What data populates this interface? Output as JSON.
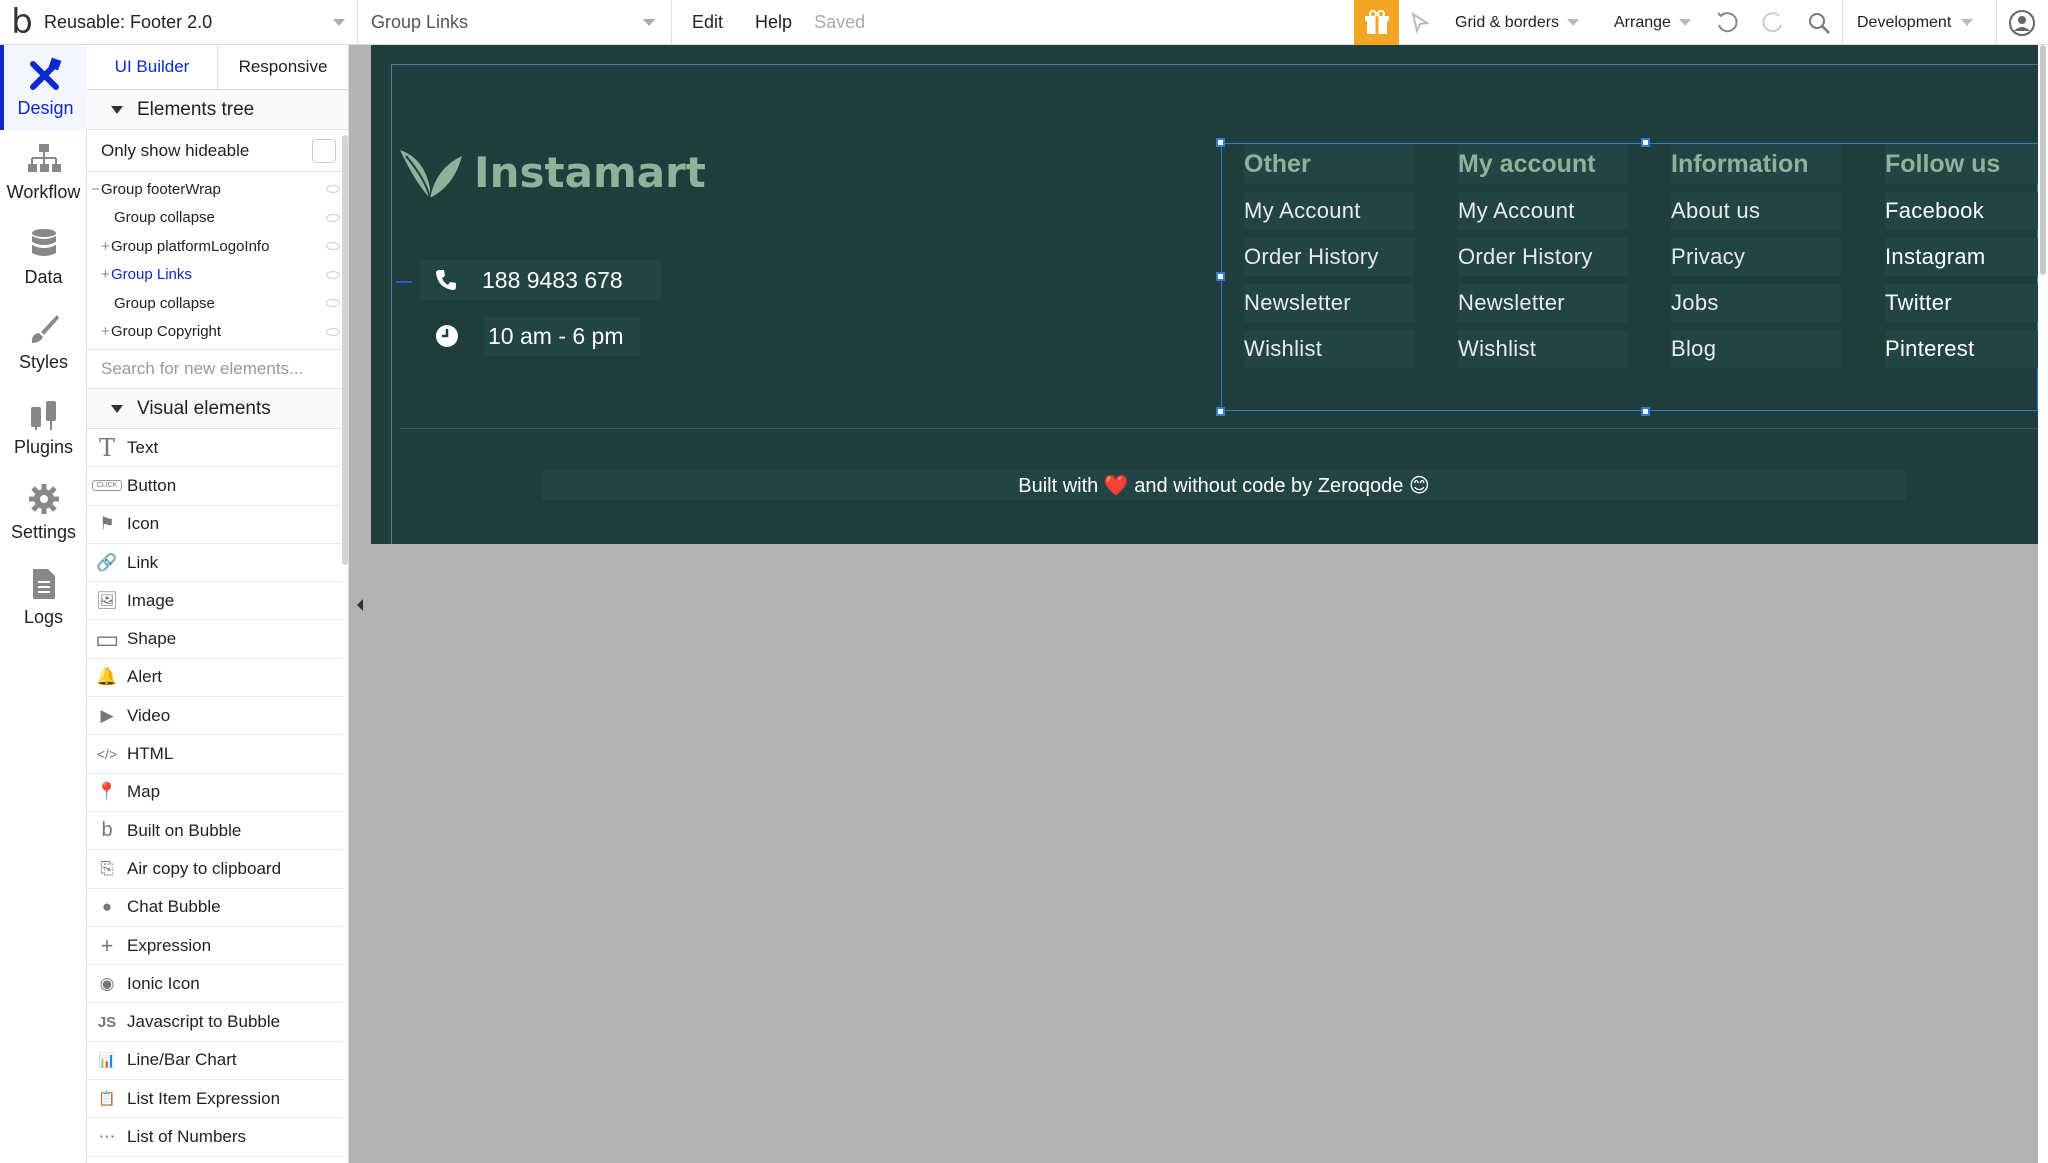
{
  "topbar": {
    "page_name": "Reusable: Footer 2.0",
    "element_select": "Group Links",
    "edit": "Edit",
    "help": "Help",
    "saved": "Saved",
    "grid": "Grid & borders",
    "arrange": "Arrange",
    "environment": "Development"
  },
  "rail": [
    {
      "label": "Design",
      "icon": "design-icon"
    },
    {
      "label": "Workflow",
      "icon": "workflow-icon"
    },
    {
      "label": "Data",
      "icon": "database-icon"
    },
    {
      "label": "Styles",
      "icon": "brush-icon"
    },
    {
      "label": "Plugins",
      "icon": "plug-icon"
    },
    {
      "label": "Settings",
      "icon": "gear-icon"
    },
    {
      "label": "Logs",
      "icon": "document-icon"
    }
  ],
  "panel": {
    "tab_builder": "UI Builder",
    "tab_responsive": "Responsive",
    "tree_header": "Elements tree",
    "only_hideable": "Only show hideable",
    "tree": [
      {
        "prefix": "−",
        "label": "Group footerWrap",
        "indent": 0
      },
      {
        "prefix": "",
        "label": "Group collapse",
        "indent": 1
      },
      {
        "prefix": "+",
        "label": "Group platformLogoInfo",
        "indent": 0
      },
      {
        "prefix": "+",
        "label": "Group Links",
        "indent": 0
      },
      {
        "prefix": "",
        "label": "Group collapse",
        "indent": 1
      },
      {
        "prefix": "+",
        "label": "Group Copyright",
        "indent": 0
      }
    ],
    "search_placeholder": "Search for new elements...",
    "visual_header": "Visual elements",
    "elements": [
      {
        "icon": "T",
        "label": "Text"
      },
      {
        "icon": "CLICK",
        "label": "Button"
      },
      {
        "icon": "⚑",
        "label": "Icon"
      },
      {
        "icon": "🔗",
        "label": "Link"
      },
      {
        "icon": "🖼",
        "label": "Image"
      },
      {
        "icon": "▭",
        "label": "Shape"
      },
      {
        "icon": "🔔",
        "label": "Alert"
      },
      {
        "icon": "▶",
        "label": "Video"
      },
      {
        "icon": "</>",
        "label": "HTML"
      },
      {
        "icon": "📍",
        "label": "Map"
      },
      {
        "icon": "b",
        "label": "Built on Bubble"
      },
      {
        "icon": "⎘",
        "label": "Air copy to clipboard"
      },
      {
        "icon": "●",
        "label": "Chat Bubble"
      },
      {
        "icon": "+",
        "label": "Expression"
      },
      {
        "icon": "◉",
        "label": "Ionic Icon"
      },
      {
        "icon": "JS",
        "label": "Javascript to Bubble"
      },
      {
        "icon": "📊",
        "label": "Line/Bar Chart"
      },
      {
        "icon": "📋",
        "label": "List Item Expression"
      },
      {
        "icon": "⋯",
        "label": "List of Numbers"
      }
    ]
  },
  "footer": {
    "brand": "Instamart",
    "phone": "188 9483 678",
    "hours": "10 am - 6 pm",
    "columns": [
      {
        "title": "Other",
        "links": [
          "My Account",
          "Order History",
          "Newsletter",
          "Wishlist"
        ]
      },
      {
        "title": "My account",
        "links": [
          "My Account",
          "Order History",
          "Newsletter",
          "Wishlist"
        ]
      },
      {
        "title": "Information",
        "links": [
          "About us",
          "Privacy",
          "Jobs",
          "Blog"
        ]
      },
      {
        "title": "Follow us",
        "links": [
          "Facebook",
          "Instagram",
          "Twitter",
          "Pinterest"
        ]
      }
    ],
    "copyright": "Built with ❤️  and without code by Zeroqode 😊"
  },
  "colors": {
    "footer_bg": "#1f3d3d",
    "brand_green": "#8db49a",
    "accent_blue": "#0c29d0",
    "gift_orange": "#f4a623"
  }
}
